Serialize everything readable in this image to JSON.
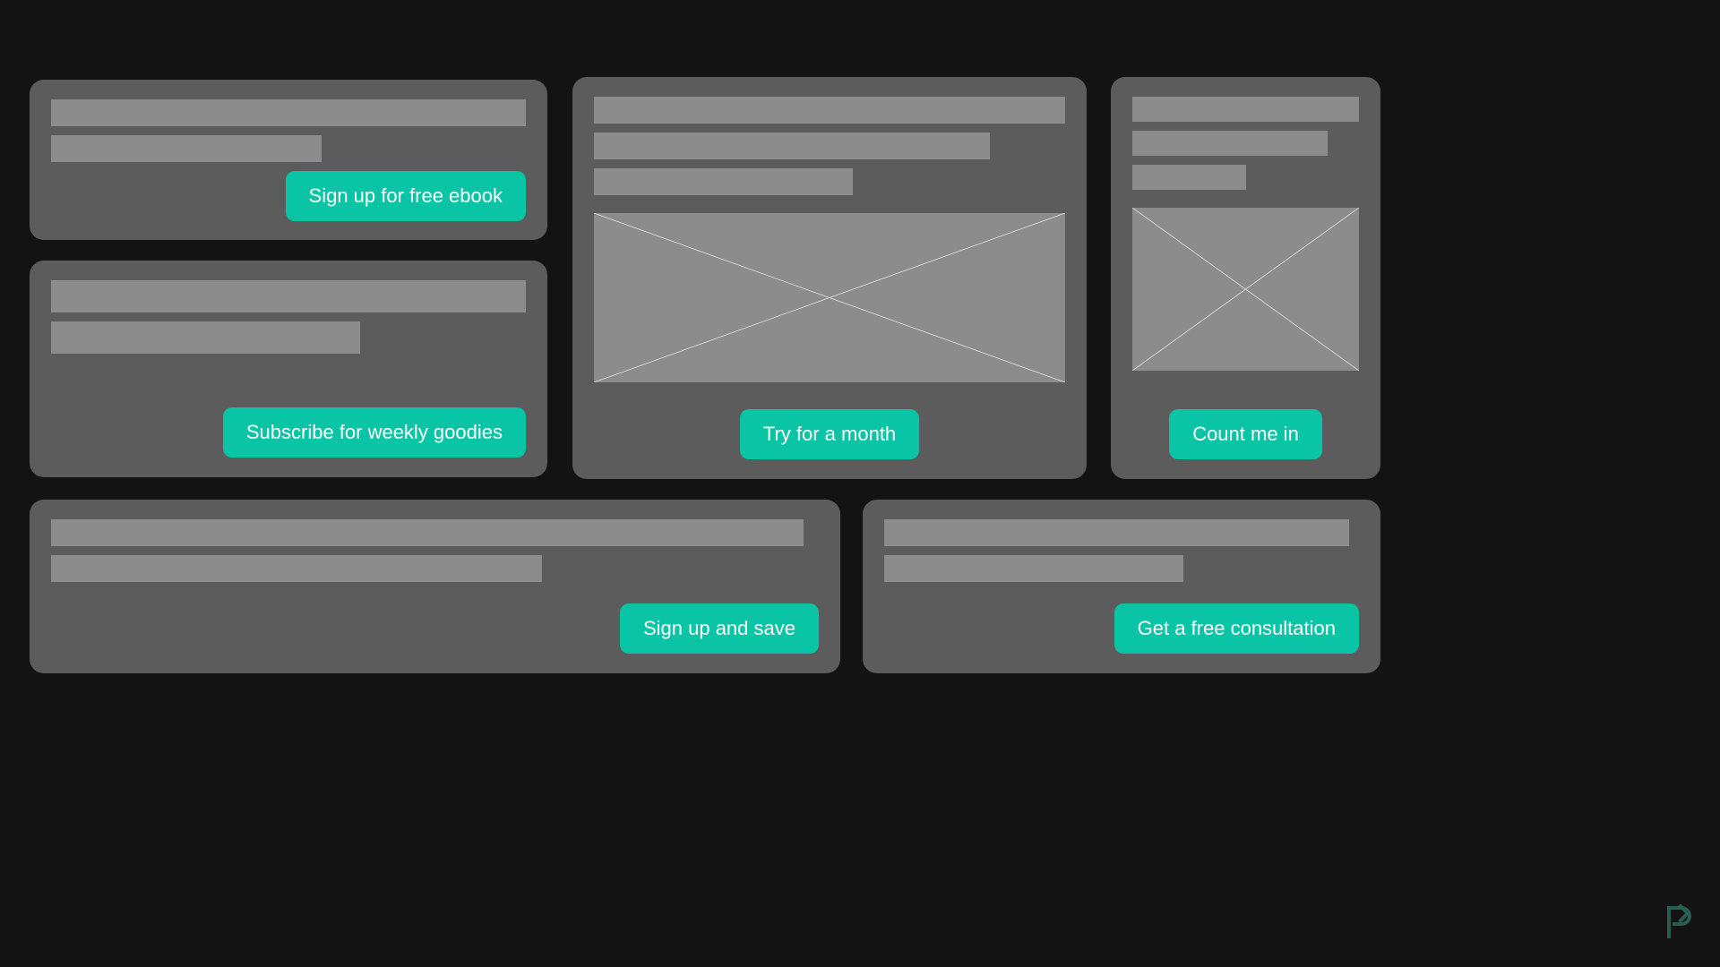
{
  "theme": {
    "page_background": "#131313",
    "card_background": "#5c5c5c",
    "placeholder_bar": "#8c8c8c",
    "image_placeholder_fill": "#8c8c8c",
    "image_placeholder_stroke": "#f0f0f0",
    "accent": "#0ac5a5",
    "button_text": "#ffffff",
    "watermark": "#2e6b5c"
  },
  "cards": [
    {
      "id": "ebook",
      "name": "ebook-signup-card",
      "bars": 2,
      "has_image": false,
      "cta_align": "right",
      "cta_label": "Sign up for free ebook"
    },
    {
      "id": "newsletter",
      "name": "newsletter-subscribe-card",
      "bars": 2,
      "has_image": false,
      "cta_align": "right",
      "cta_label": "Subscribe for weekly goodies"
    },
    {
      "id": "trial",
      "name": "trial-offer-card",
      "bars": 3,
      "has_image": true,
      "cta_align": "center",
      "cta_label": "Try for a month"
    },
    {
      "id": "membership",
      "name": "membership-signup-card",
      "bars": 3,
      "has_image": true,
      "cta_align": "center",
      "cta_label": "Count me in"
    },
    {
      "id": "save",
      "name": "savings-signup-card",
      "bars": 2,
      "has_image": false,
      "cta_align": "right",
      "cta_label": "Sign up and save"
    },
    {
      "id": "consultation",
      "name": "consultation-card",
      "bars": 2,
      "has_image": false,
      "cta_align": "right",
      "cta_label": "Get a free consultation"
    }
  ],
  "watermark": {
    "icon": "p-arrow-logo-icon",
    "color": "#2e6b5c"
  }
}
